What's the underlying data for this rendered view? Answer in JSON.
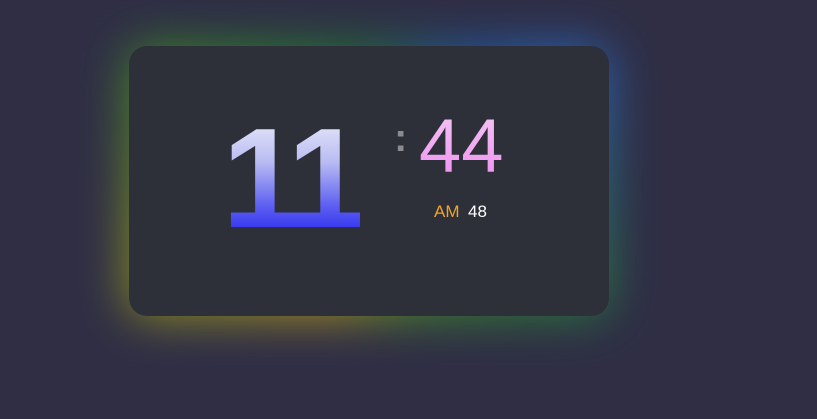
{
  "clock": {
    "hours": "11",
    "separator": ":",
    "minutes": "44",
    "period": "AM",
    "seconds": "48"
  },
  "colors": {
    "background": "#2f2e45",
    "card": "#2d2f39",
    "hours_gradient_top": "#f1f2fb",
    "hours_gradient_bottom": "#1616ee",
    "minutes": "#ee8df1",
    "period": "#f0a52a",
    "seconds": "#ffffff",
    "separator": "#8a8a8f",
    "glow": [
      "#c9a21a",
      "#2f8f2a",
      "#1e5fb0"
    ]
  }
}
